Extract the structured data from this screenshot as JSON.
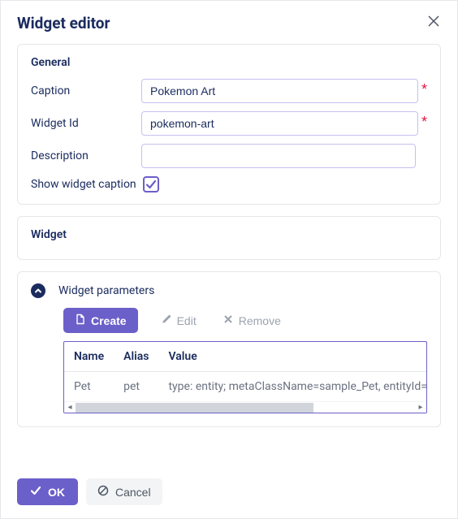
{
  "dialog": {
    "title": "Widget editor"
  },
  "general": {
    "legend": "General",
    "caption_label": "Caption",
    "caption_value": "Pokemon Art",
    "widget_id_label": "Widget Id",
    "widget_id_value": "pokemon-art",
    "description_label": "Description",
    "description_value": "",
    "show_caption_label": "Show widget caption",
    "show_caption_checked": true
  },
  "widget": {
    "legend": "Widget"
  },
  "parameters": {
    "legend": "Widget parameters",
    "toolbar": {
      "create_label": "Create",
      "edit_label": "Edit",
      "remove_label": "Remove"
    },
    "columns": {
      "name": "Name",
      "alias": "Alias",
      "value": "Value"
    },
    "rows": [
      {
        "name": "Pet",
        "alias": "pet",
        "value": "type: entity; metaClassName=sample_Pet, entityId="
      }
    ]
  },
  "footer": {
    "ok_label": "OK",
    "cancel_label": "Cancel"
  }
}
